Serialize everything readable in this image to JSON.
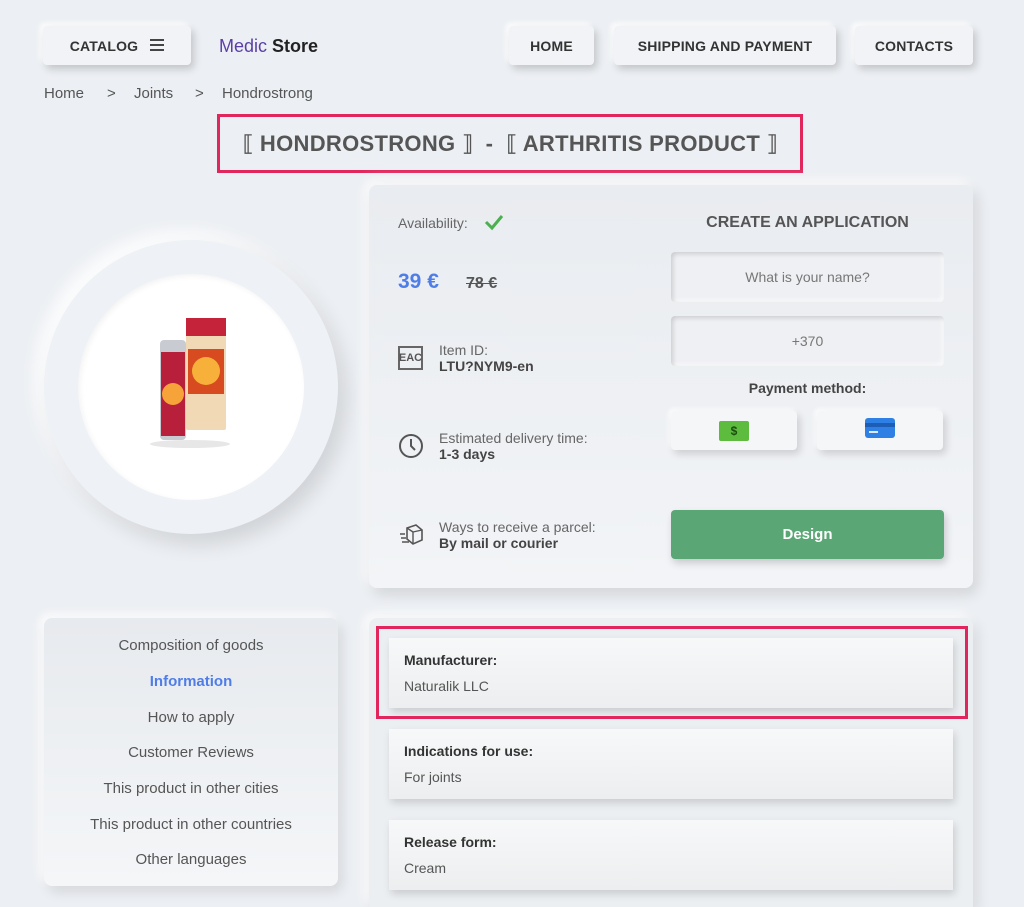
{
  "header": {
    "catalog_label": "CATALOG",
    "logo_a": "Medic",
    "logo_b": "Store",
    "nav": [
      "HOME",
      "SHIPPING AND PAYMENT",
      "CONTACTS"
    ]
  },
  "breadcrumb": [
    "Home",
    ">",
    "Joints",
    ">",
    "Hondrostrong"
  ],
  "page_title": "⟦ HONDROSTRONG ⟧  -  ⟦ ARTHRITIS PRODUCT ⟧",
  "product": {
    "availability_label": "Availability:",
    "price_new": "39 €",
    "price_old": "78 €",
    "item_id_label": "Item ID:",
    "item_id_value": "LTU?NYM9-en",
    "delivery_label": "Estimated delivery time:",
    "delivery_value": "1-3 days",
    "parcel_label": "Ways to receive a parcel:",
    "parcel_value": "By mail or courier",
    "eac_mark": "EAC"
  },
  "form": {
    "title": "CREATE AN APPLICATION",
    "name_placeholder": "What is your name?",
    "phone_value": "+370",
    "payment_label": "Payment method:",
    "submit_label": "Design",
    "cash_symbol": "$"
  },
  "tabs": [
    "Composition of goods",
    "Information",
    "How to apply",
    "Customer Reviews",
    "This product in other cities",
    "This product in other countries",
    "Other languages"
  ],
  "info": [
    {
      "key": "Manufacturer:",
      "value": "Naturalik LLC"
    },
    {
      "key": "Indications for use:",
      "value": "For joints"
    },
    {
      "key": "Release form:",
      "value": "Cream"
    }
  ],
  "colors": {
    "accent_price": "#4f7de8",
    "highlight": "#e0265c",
    "design_button": "#5aa775",
    "check": "#4caf50"
  }
}
